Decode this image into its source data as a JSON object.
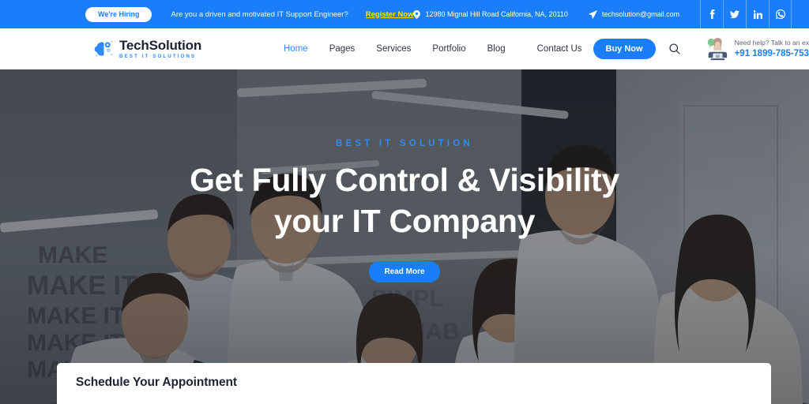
{
  "topbar": {
    "hiring_badge": "We're Hiring",
    "hiring_message": "Are you a driven and motivated IT Support Engineer?",
    "register_link": "Register Now",
    "address": "12980 Mignal Hill Road California, NA, 20110",
    "email": "techsolution@gmail.com",
    "address_icon": "location-pin-icon",
    "email_icon": "paper-plane-icon",
    "socials": [
      {
        "name": "facebook-icon",
        "glyph": "f"
      },
      {
        "name": "twitter-icon",
        "glyph": "t"
      },
      {
        "name": "linkedin-icon",
        "glyph": "in"
      },
      {
        "name": "whatsapp-icon",
        "glyph": "w"
      }
    ],
    "bg_color": "#1a7efb",
    "link_color": "#ffe600"
  },
  "header": {
    "logo": {
      "title": "TechSolution",
      "tagline": "BEST IT SOLUTIONS",
      "icon": "brain-gear-icon"
    },
    "nav": [
      {
        "label": "Home",
        "active": true
      },
      {
        "label": "Pages",
        "active": false
      },
      {
        "label": "Services",
        "active": false
      },
      {
        "label": "Portfolio",
        "active": false
      },
      {
        "label": "Blog",
        "active": false
      }
    ],
    "contact_label": "Contact Us",
    "buy_label": "Buy Now",
    "search_icon": "search-icon",
    "support": {
      "label": "Need help? Talk to an expert",
      "phone": "+91 1899-785-753",
      "avatar_icon": "support-agent-icon"
    },
    "accent_color": "#1a7efb"
  },
  "hero": {
    "eyebrow": "BEST IT SOLUTION",
    "title_line1": "Get Fully Control & Visibility",
    "title_line2": "your IT Company",
    "cta_label": "Read More",
    "accent_color": "#2f8bfb"
  },
  "appointment": {
    "title": "Schedule Your Appointment"
  }
}
